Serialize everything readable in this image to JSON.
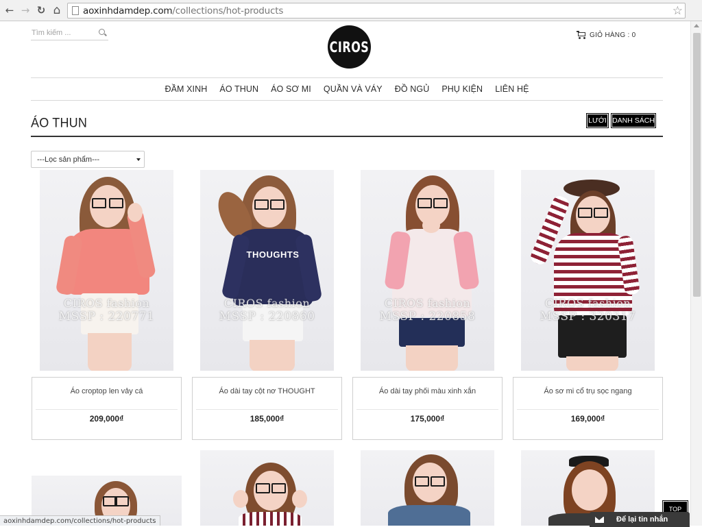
{
  "browser": {
    "url_domain": "aoxinhdamdep.com",
    "url_path": "/collections/hot-products",
    "back_glyph": "←",
    "forward_glyph": "→",
    "reload_glyph": "↻",
    "home_glyph": "⌂",
    "star_glyph": "☆"
  },
  "header": {
    "search_placeholder": "Tìm kiếm ...",
    "logo_text": "CIROS",
    "cart_label": "GIỎ HÀNG : 0"
  },
  "nav": {
    "items": [
      {
        "label": "ĐẦM XINH"
      },
      {
        "label": "ÁO THUN"
      },
      {
        "label": "ÁO SƠ MI"
      },
      {
        "label": "QUẦN VÀ VÁY"
      },
      {
        "label": "ĐỒ NGỦ"
      },
      {
        "label": "PHỤ KIỆN"
      },
      {
        "label": "LIÊN HỆ"
      }
    ]
  },
  "collection": {
    "title": "ÁO THUN",
    "view_grid_label": "LƯỚI",
    "view_list_label": "DANH SÁCH",
    "filter_selected": "---Lọc sản phẩm---"
  },
  "products": [
    {
      "name": "Áo croptop len vảy cá",
      "price": "209,000₫",
      "watermark_brand": "CIROS fashion",
      "watermark_code": "MSSP : 220771"
    },
    {
      "name": "Áo dài tay cột nơ THOUGHT",
      "price": "185,000₫",
      "watermark_brand": "CIROS fashion",
      "watermark_code": "MSSP : 220860",
      "shirt_text": "THOUGHTS"
    },
    {
      "name": "Áo dài tay phối màu xinh xắn",
      "price": "175,000₫",
      "watermark_brand": "CIROS fashion",
      "watermark_code": "MSSP : 220858"
    },
    {
      "name": "Áo sơ mi cổ trụ sọc ngang",
      "price": "169,000₫",
      "watermark_brand": "CIROS fashion",
      "watermark_code": "MSSP : 320317"
    }
  ],
  "widgets": {
    "top_label": "TOP",
    "message_label": "Để lại tin nhắn"
  },
  "status_bar": {
    "text": "aoxinhdamdep.com/collections/hot-products"
  },
  "colors": {
    "accent": "#000000",
    "rule": "#d8d8d8",
    "shirt_1": "#f2867e",
    "shirt_2": "#2a2e5a",
    "shirt_3": "#f2a3b0",
    "shirt_4_stripe": "#8e2236"
  }
}
